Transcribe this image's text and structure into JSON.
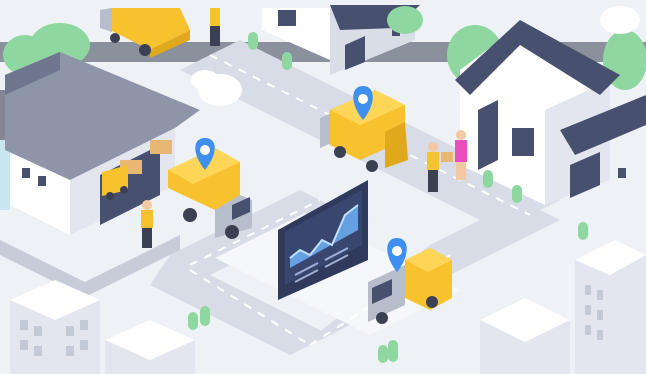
{
  "scene": {
    "kind": "isometric delivery logistics illustration",
    "colors": {
      "background": "#eef1f6",
      "road": "#d7dce6",
      "ground": "#f6f7fa",
      "roof": "#47506f",
      "roof_gray": "#8e95a9",
      "wall": "#ffffff",
      "truck_yellow": "#f8c12e",
      "truck_cab": "#b7bdca",
      "pin": "#3f8ff0",
      "tree": "#8fd7a0",
      "dashboard": "#2f3a5d",
      "chart_line": "#6fb6ff"
    },
    "elements": [
      {
        "name": "warehouse",
        "count": 1
      },
      {
        "name": "delivery-truck",
        "count": 4
      },
      {
        "name": "location-pin",
        "count": 3
      },
      {
        "name": "house",
        "count": 2
      },
      {
        "name": "delivery-worker",
        "count": 3
      },
      {
        "name": "customer",
        "count": 1
      },
      {
        "name": "analytics-dashboard",
        "count": 1
      },
      {
        "name": "office-building",
        "count": 3
      },
      {
        "name": "tree",
        "count": 5
      }
    ]
  }
}
